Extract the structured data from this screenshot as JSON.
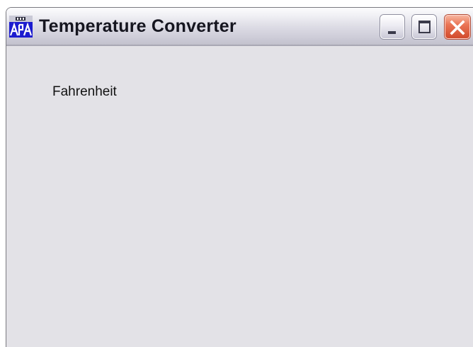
{
  "window": {
    "title": "Temperature Converter",
    "app_icon": "app-window-icon",
    "controls": {
      "minimize_icon": "minimize-icon",
      "maximize_icon": "maximize-icon",
      "close_icon": "close-icon"
    }
  },
  "content": {
    "fahrenheit_label": "Fahrenheit"
  },
  "colors": {
    "client_background": "#e3e2e7",
    "close_button": "#e0603f"
  }
}
